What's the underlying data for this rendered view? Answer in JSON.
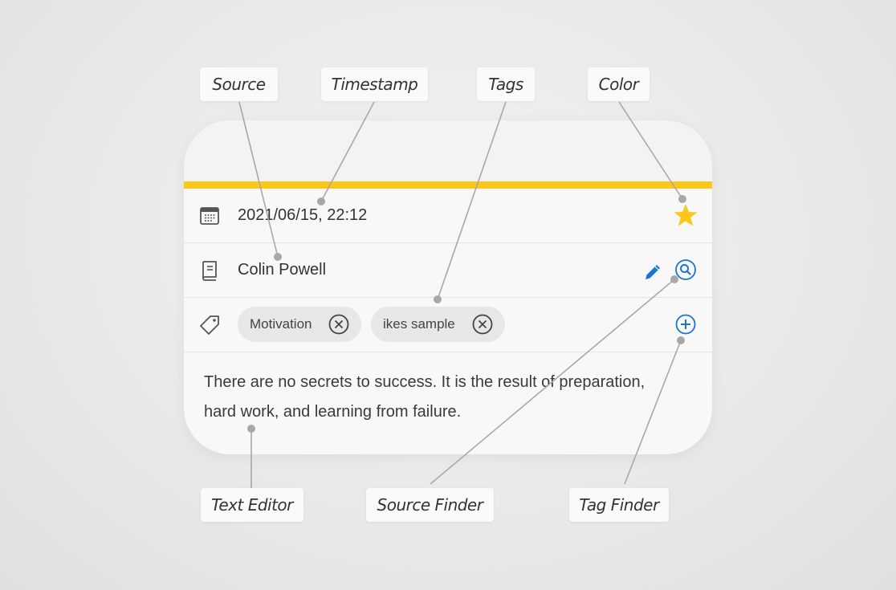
{
  "colors": {
    "accent_bar": "#fbc81a",
    "star": "#fbc81a",
    "action_blue": "#1677d2",
    "icon_gray": "#555555"
  },
  "note": {
    "timestamp": "2021/06/15, 22:12",
    "source": "Colin Powell",
    "tags": [
      {
        "label": "Motivation",
        "remove_icon": "close-circle-icon"
      },
      {
        "label": "ikes sample",
        "remove_icon": "close-circle-icon"
      }
    ],
    "text": "There are no secrets to success. It is the result of preparation, hard work, and learning from failure.",
    "icons": {
      "timestamp": "calendar-icon",
      "source": "book-icon",
      "tags": "tag-icon",
      "color": "star-icon",
      "edit_source": "pencil-icon",
      "find_source": "search-circle-icon",
      "add_tag": "plus-circle-icon"
    }
  },
  "callouts": {
    "source": "Source",
    "timestamp": "Timestamp",
    "tags": "Tags",
    "color": "Color",
    "text_editor": "Text Editor",
    "source_finder": "Source Finder",
    "tag_finder": "Tag Finder"
  }
}
